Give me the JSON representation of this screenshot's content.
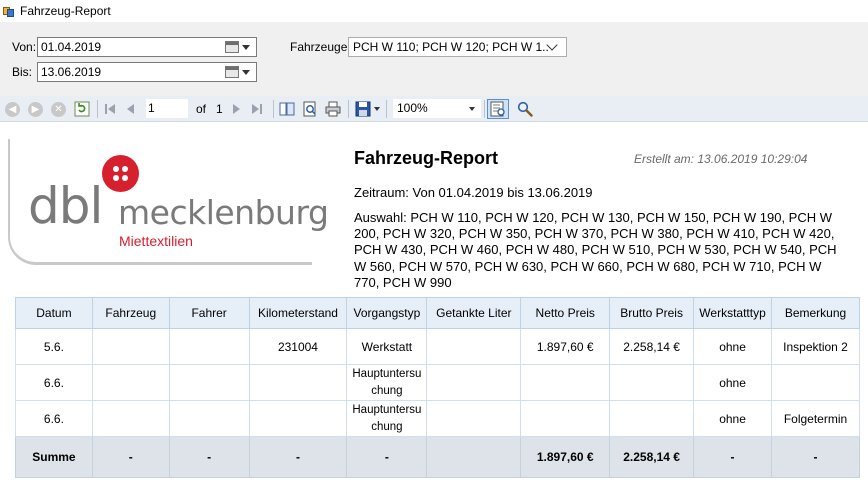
{
  "window": {
    "title": "Fahrzeug-Report"
  },
  "filters": {
    "von_label": "Von:",
    "von_value": "01.04.2019",
    "bis_label": "Bis:",
    "bis_value": "13.06.2019",
    "fahrzeuge_label": "Fahrzeuge:",
    "fahrzeuge_value": "PCH W 110; PCH W 120; PCH W 1..."
  },
  "toolbar": {
    "page_current": "1",
    "page_of_label": "of",
    "page_total": "1",
    "zoom_value": "100%"
  },
  "report": {
    "logo": {
      "brand": "dbl",
      "region": "mecklenburg",
      "tagline": "Miettextilien"
    },
    "title": "Fahrzeug-Report",
    "created": "Erstellt am: 13.06.2019 10:29:04",
    "period": "Zeitraum: Von 01.04.2019 bis 13.06.2019",
    "selection": "Auswahl: PCH W 110, PCH W 120, PCH W 130, PCH W 150, PCH W 190, PCH W 200, PCH W 320, PCH W 350, PCH W 370, PCH W 380, PCH W 410, PCH W 420, PCH W 430, PCH W 460, PCH W 480, PCH W 510, PCH W 530, PCH W 540, PCH W 560, PCH W 570, PCH W 630, PCH W 660, PCH W 680, PCH W 710, PCH W 770, PCH W 990",
    "table": {
      "headers": [
        "Datum",
        "Fahrzeug",
        "Fahrer",
        "Kilometerstand",
        "Vorgangstyp",
        "Getankte Liter",
        "Netto Preis",
        "Brutto Preis",
        "Werkstatttyp",
        "Bemerkung"
      ],
      "rows": [
        [
          "5.6.",
          "",
          "",
          "231004",
          "Werkstatt",
          "",
          "1.897,60 €",
          "2.258,14 €",
          "ohne",
          "Inspektion 2"
        ],
        [
          "6.6.",
          "",
          "",
          "",
          "Hauptuntersu chung",
          "",
          "",
          "",
          "ohne",
          ""
        ],
        [
          "6.6.",
          "",
          "",
          "",
          "Hauptuntersu chung",
          "",
          "",
          "",
          "ohne",
          "Folgetermin"
        ]
      ],
      "sum_row": [
        "Summe",
        "-",
        "-",
        "-",
        "-",
        "",
        "1.897,60 €",
        "2.258,14 €",
        "-",
        "-"
      ]
    }
  }
}
